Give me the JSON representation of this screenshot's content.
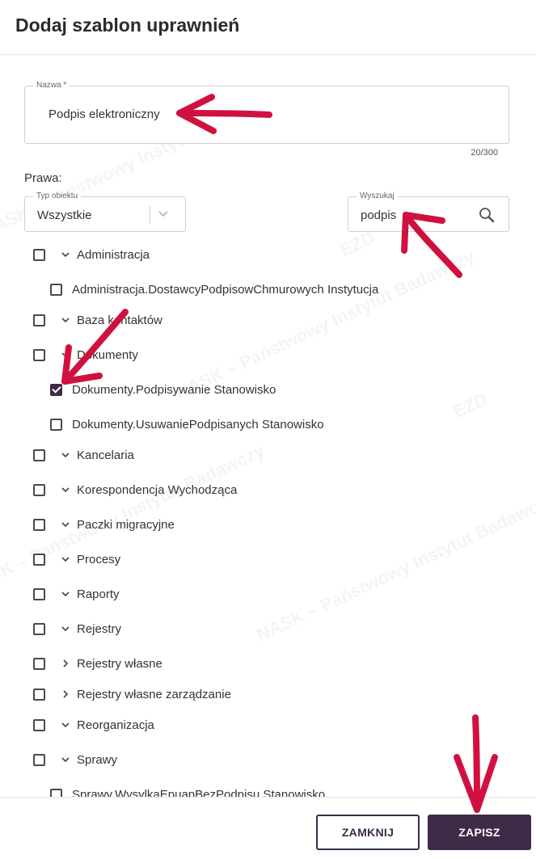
{
  "dialog": {
    "title": "Dodaj szablon uprawnień"
  },
  "name_field": {
    "label": "Nazwa *",
    "value": "Podpis elektroniczny",
    "counter": "20/300"
  },
  "rights": {
    "label": "Prawa:"
  },
  "object_type": {
    "label": "Typ obiektu",
    "value": "Wszystkie"
  },
  "search": {
    "label": "Wyszukaj",
    "value": "podpis",
    "icon": "search-icon"
  },
  "tree": [
    {
      "label": "Administracja",
      "level": 0,
      "expanded": true,
      "checked": false
    },
    {
      "label": "Administracja.DostawcyPodpisowChmurowych Instytucja",
      "level": 1,
      "checked": false
    },
    {
      "label": "Baza kontaktów",
      "level": 0,
      "expanded": true,
      "checked": false
    },
    {
      "label": "Dokumenty",
      "level": 0,
      "expanded": true,
      "checked": false
    },
    {
      "label": "Dokumenty.Podpisywanie Stanowisko",
      "level": 1,
      "checked": true
    },
    {
      "label": "Dokumenty.UsuwaniePodpisanych Stanowisko",
      "level": 1,
      "checked": false
    },
    {
      "label": "Kancelaria",
      "level": 0,
      "expanded": true,
      "checked": false
    },
    {
      "label": "Korespondencja Wychodząca",
      "level": 0,
      "expanded": true,
      "checked": false
    },
    {
      "label": "Paczki migracyjne",
      "level": 0,
      "expanded": true,
      "checked": false
    },
    {
      "label": "Procesy",
      "level": 0,
      "expanded": true,
      "checked": false
    },
    {
      "label": "Raporty",
      "level": 0,
      "expanded": true,
      "checked": false
    },
    {
      "label": "Rejestry",
      "level": 0,
      "expanded": true,
      "checked": false
    },
    {
      "label": "Rejestry własne",
      "level": 0,
      "expanded": false,
      "checked": false
    },
    {
      "label": "Rejestry własne zarządzanie",
      "level": 0,
      "expanded": false,
      "checked": false
    },
    {
      "label": "Reorganizacja",
      "level": 0,
      "expanded": true,
      "checked": false
    },
    {
      "label": "Sprawy",
      "level": 0,
      "expanded": true,
      "checked": false
    },
    {
      "label": "Sprawy.WysylkaEpuapBezPodpisu Stanowisko",
      "level": 1,
      "checked": false
    }
  ],
  "footer": {
    "close_label": "ZAMKNIJ",
    "save_label": "ZAPISZ"
  },
  "watermark": {
    "text_1": "NASK – Państwowy Instytut Badawczy",
    "text_2": "EZD"
  },
  "colors": {
    "primary": "#3f2a48",
    "annotation_arrow": "#d0113f"
  }
}
